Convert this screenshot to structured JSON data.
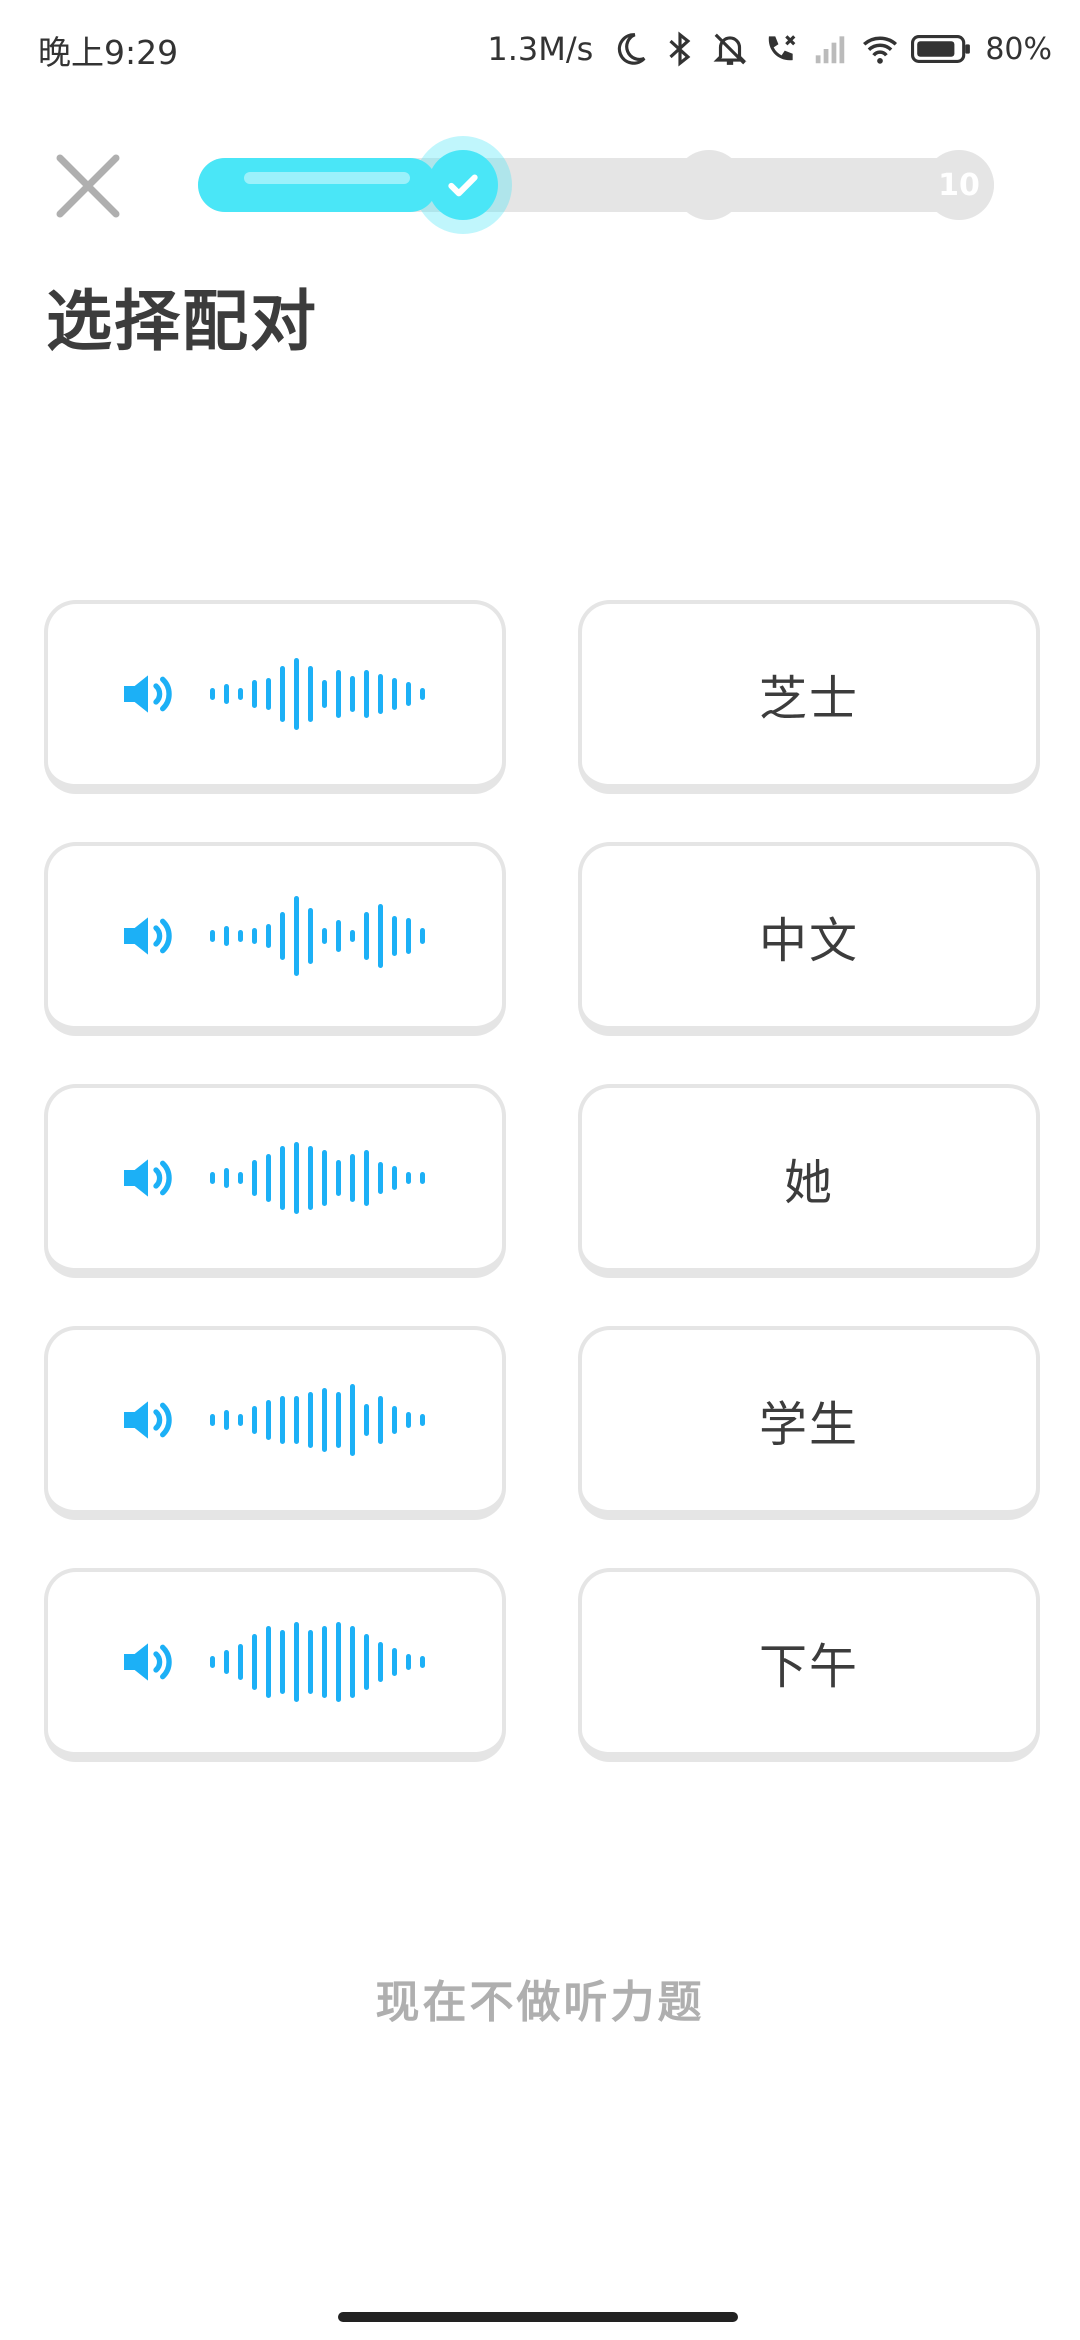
{
  "status_bar": {
    "time": "晚上9:29",
    "network_speed": "1.3M/s",
    "battery_percent": "80%",
    "icons": [
      "moon-icon",
      "bluetooth-icon",
      "mute-icon",
      "call-icon",
      "signal-icon",
      "wifi-icon",
      "battery-icon"
    ]
  },
  "header": {
    "close_icon": "close-icon",
    "progress": {
      "fraction": 0.3,
      "checkpoints": [
        {
          "state": "done",
          "icon": "check-icon"
        },
        {
          "state": "pending",
          "label": ""
        },
        {
          "state": "pending",
          "label": "10"
        }
      ],
      "fill_color": "#4ae6f7",
      "track_color": "#e5e5e5"
    }
  },
  "title": "选择配对",
  "pairs": {
    "audio_items": [
      {
        "icon": "speaker-icon",
        "waveform": [
          3,
          5,
          3,
          7,
          8,
          14,
          18,
          14,
          7,
          12,
          9,
          12,
          10,
          8,
          6,
          3
        ]
      },
      {
        "icon": "speaker-icon",
        "waveform": [
          3,
          5,
          3,
          4,
          6,
          12,
          20,
          14,
          4,
          8,
          3,
          12,
          16,
          10,
          9,
          4
        ]
      },
      {
        "icon": "speaker-icon",
        "waveform": [
          3,
          5,
          3,
          9,
          12,
          16,
          18,
          16,
          14,
          9,
          12,
          14,
          8,
          6,
          3,
          3
        ]
      },
      {
        "icon": "speaker-icon",
        "waveform": [
          3,
          5,
          3,
          7,
          10,
          12,
          12,
          14,
          16,
          14,
          18,
          8,
          12,
          7,
          4,
          3
        ]
      },
      {
        "icon": "speaker-icon",
        "waveform": [
          3,
          6,
          9,
          14,
          18,
          16,
          20,
          16,
          18,
          20,
          18,
          14,
          10,
          7,
          4,
          3
        ]
      }
    ],
    "word_items": [
      "芝士",
      "中文",
      "她",
      "学生",
      "下午"
    ]
  },
  "skip_label": "现在不做听力题",
  "colors": {
    "accent": "#1cb0f6",
    "text": "#3c3c3c",
    "muted": "#afafaf",
    "border": "#e5e5e5"
  }
}
